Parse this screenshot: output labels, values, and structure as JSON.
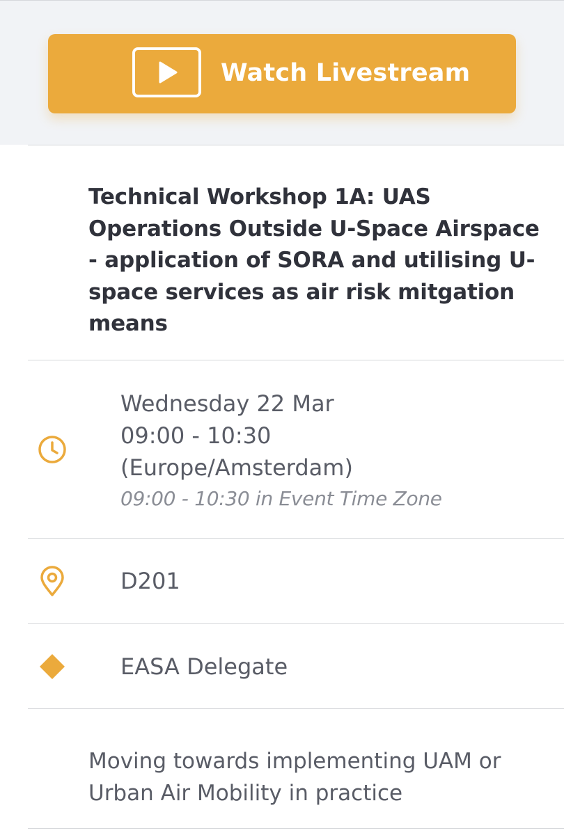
{
  "livestream": {
    "label": "Watch Livestream",
    "icon": "play-icon"
  },
  "session": {
    "title": "Technical Workshop 1A: UAS Operations Outside U-Space Airspace - application of SORA and utilising U-space services as air risk mitgation means",
    "title_lines": [
      "Technical Workshop 1A: UAS",
      "Operations Outside U-Space Airspace",
      "- application of SORA and utilising U-",
      "space services as air risk mitgation",
      "means"
    ]
  },
  "time": {
    "icon": "clock-icon",
    "date": "Wednesday 22 Mar",
    "range": "09:00 - 10:30",
    "timezone": "(Europe/Amsterdam)",
    "event_time_zone": "09:00 - 10:30 in Event Time Zone"
  },
  "location": {
    "icon": "map-pin-icon",
    "room": "D201"
  },
  "audience": {
    "icon": "diamond-icon",
    "label": "EASA Delegate"
  },
  "description": {
    "lines": [
      "Moving towards implementing UAM or",
      "Urban Air Mobility in practice"
    ]
  },
  "colors": {
    "accent": "#ebaa3c",
    "title_text": "#30323b",
    "body_text": "#595c66",
    "muted_text": "#8a8d95",
    "band_background": "#f1f3f6",
    "divider": "#d5d7da"
  }
}
